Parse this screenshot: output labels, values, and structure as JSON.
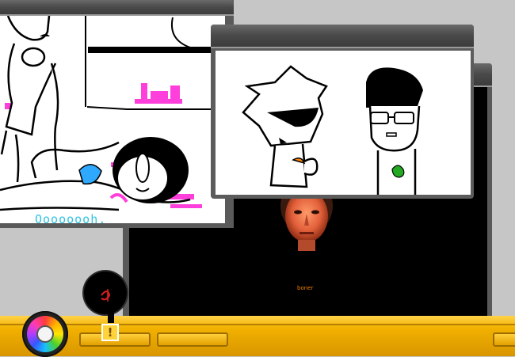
{
  "windows": {
    "left": {
      "caption": "Oooooooh."
    },
    "back": {
      "caption": "boner"
    },
    "front": {}
  },
  "taskbar": {
    "slot_count": 3
  },
  "colors": {
    "taskbar_accent": "#f2b200",
    "window_chrome": "#4a4a4a",
    "pink_scribble": "#ff3fdc",
    "cyan_text": "#2fc3e0",
    "orange_text": "#f08000"
  },
  "icons": {
    "start": "color-wheel-icon",
    "bubble": "chat-bubble-icon",
    "alert": "alert-icon"
  },
  "alert_glyph": "!"
}
